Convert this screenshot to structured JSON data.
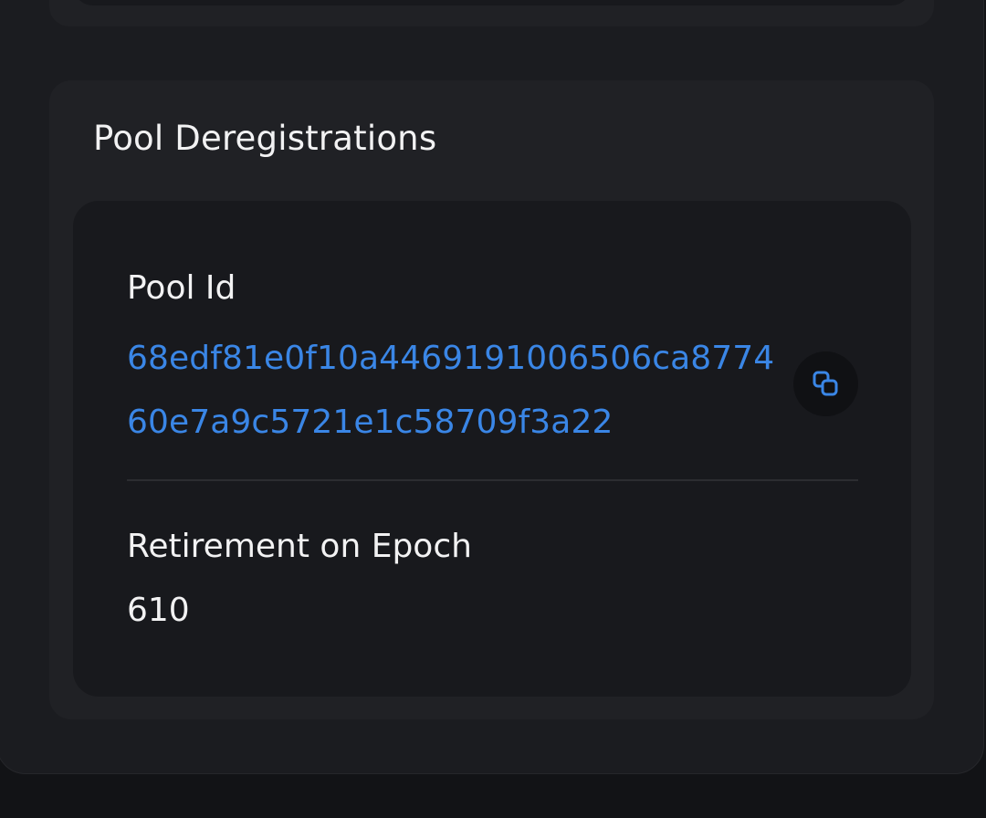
{
  "section": {
    "title": "Pool Deregistrations"
  },
  "deregistration": {
    "pool_id_label": "Pool Id",
    "pool_id": "68edf81e0f10a4469191006506ca877460e7a9c5721e1c58709f3a22",
    "retirement_label": "Retirement on Epoch",
    "retirement_epoch": "610"
  },
  "icons": {
    "copy": "copy-icon"
  },
  "colors": {
    "background": "#121316",
    "panel": "#1b1c20",
    "card": "#202125",
    "inner_card": "#18191d",
    "text": "#f2f2f3",
    "link": "#3a86e6"
  }
}
